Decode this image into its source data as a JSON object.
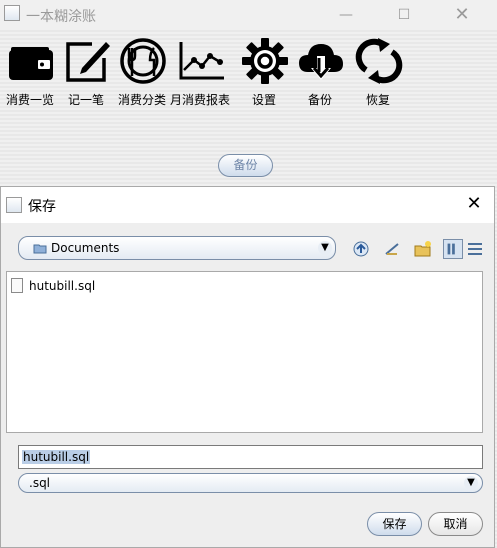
{
  "main_window": {
    "title": "一本糊涂账",
    "minimize_glyph": "—",
    "maximize_glyph": "☐",
    "close_glyph": "✕"
  },
  "toolbar": [
    {
      "label": "消费一览",
      "icon": "wallet-icon"
    },
    {
      "label": "记一笔",
      "icon": "edit-icon"
    },
    {
      "label": "消费分类",
      "icon": "dining-icon"
    },
    {
      "label": "月消费报表",
      "icon": "line-chart-icon"
    },
    {
      "label": "设置",
      "icon": "gear-icon"
    },
    {
      "label": "备份",
      "icon": "cloud-download-icon"
    },
    {
      "label": "恢复",
      "icon": "refresh-icon"
    }
  ],
  "backup_panel": {
    "button_label": "备份"
  },
  "save_dialog": {
    "title": "保存",
    "close_glyph": "✕",
    "location": "Documents",
    "files": [
      {
        "name": "hutubill.sql",
        "icon": "file-icon"
      }
    ],
    "filename_value": "hutubill.sql",
    "filetype_value": ".sql",
    "save_label": "保存",
    "cancel_label": "取消"
  },
  "colors": {
    "accent": "#b9cde6",
    "button_border": "#7a8ea8"
  }
}
